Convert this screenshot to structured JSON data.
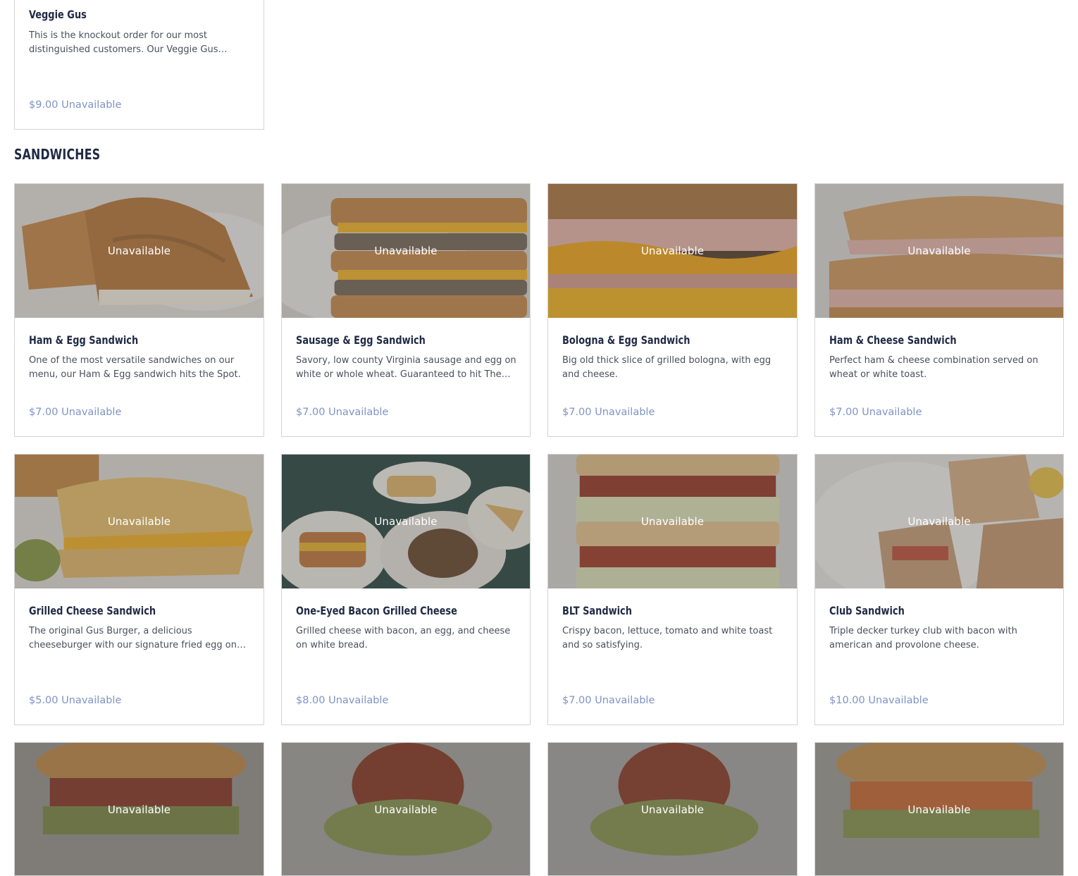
{
  "top_item": {
    "title": "Veggie Gus",
    "description": "This is the knockout order for our most distinguished customers. Our Veggie Gus arrive…",
    "price": "$9.00",
    "status": "Unavailable"
  },
  "sandwiches": {
    "section_title": "SANDWICHES",
    "items": [
      {
        "title": "Ham & Egg Sandwich",
        "description": "One of the most versatile sandwiches on our menu, our Ham & Egg sandwich hits the Spot.",
        "price": "$7.00",
        "status": "Unavailable",
        "image_label": "Unavailable"
      },
      {
        "title": "Sausage & Egg Sandwich",
        "description": "Savory, low county Virginia sausage and egg on white or whole wheat. Guaranteed to hit The…",
        "price": "$7.00",
        "status": "Unavailable",
        "image_label": "Unavailable"
      },
      {
        "title": "Bologna & Egg Sandwich",
        "description": "Big old thick slice of grilled bologna, with egg and cheese.",
        "price": "$7.00",
        "status": "Unavailable",
        "image_label": "Unavailable"
      },
      {
        "title": "Ham & Cheese Sandwich",
        "description": "Perfect ham & cheese combination served on wheat or white toast.",
        "price": "$7.00",
        "status": "Unavailable",
        "image_label": "Unavailable"
      },
      {
        "title": "Grilled Cheese Sandwich",
        "description": "The original Gus Burger, a delicious cheeseburger with our signature fried egg on top, nurturing…",
        "price": "$5.00",
        "status": "Unavailable",
        "image_label": "Unavailable"
      },
      {
        "title": "One-Eyed Bacon Grilled Cheese",
        "description": "Grilled cheese with bacon, an egg, and cheese on white bread.",
        "price": "$8.00",
        "status": "Unavailable",
        "image_label": "Unavailable"
      },
      {
        "title": "BLT Sandwich",
        "description": "Crispy bacon, lettuce, tomato and white toast and so satisfying.",
        "price": "$7.00",
        "status": "Unavailable",
        "image_label": "Unavailable"
      },
      {
        "title": "Club Sandwich",
        "description": "Triple decker turkey club with bacon with american and provolone cheese.",
        "price": "$10.00",
        "status": "Unavailable",
        "image_label": "Unavailable"
      }
    ],
    "partial_row": [
      {
        "image_label": "Unavailable"
      },
      {
        "image_label": "Unavailable"
      },
      {
        "image_label": "Unavailable"
      },
      {
        "image_label": "Unavailable"
      }
    ]
  },
  "colors": {
    "title": "#1f2a44",
    "price": "#7f93c4",
    "border": "#d4d4d4",
    "overlay_text": "#ffffff"
  }
}
